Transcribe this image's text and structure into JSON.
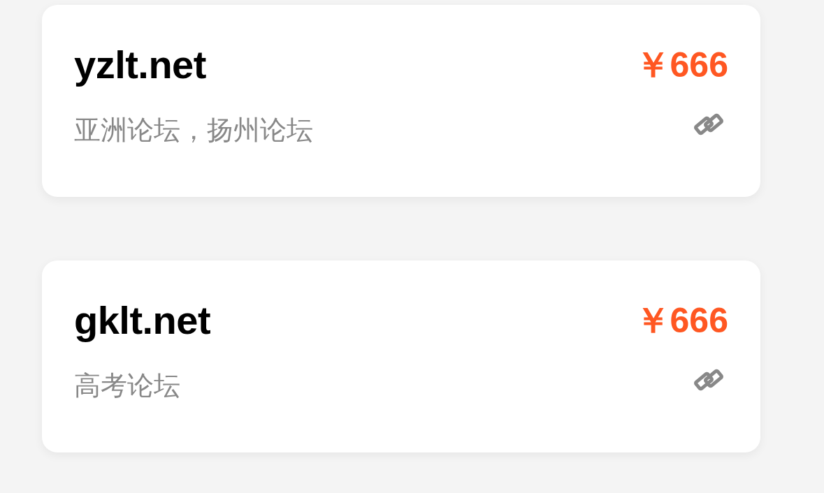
{
  "listings": [
    {
      "domain": "yzlt.net",
      "price": "￥666",
      "description": "亚洲论坛，扬州论坛"
    },
    {
      "domain": "gklt.net",
      "price": "￥666",
      "description": "高考论坛"
    }
  ]
}
